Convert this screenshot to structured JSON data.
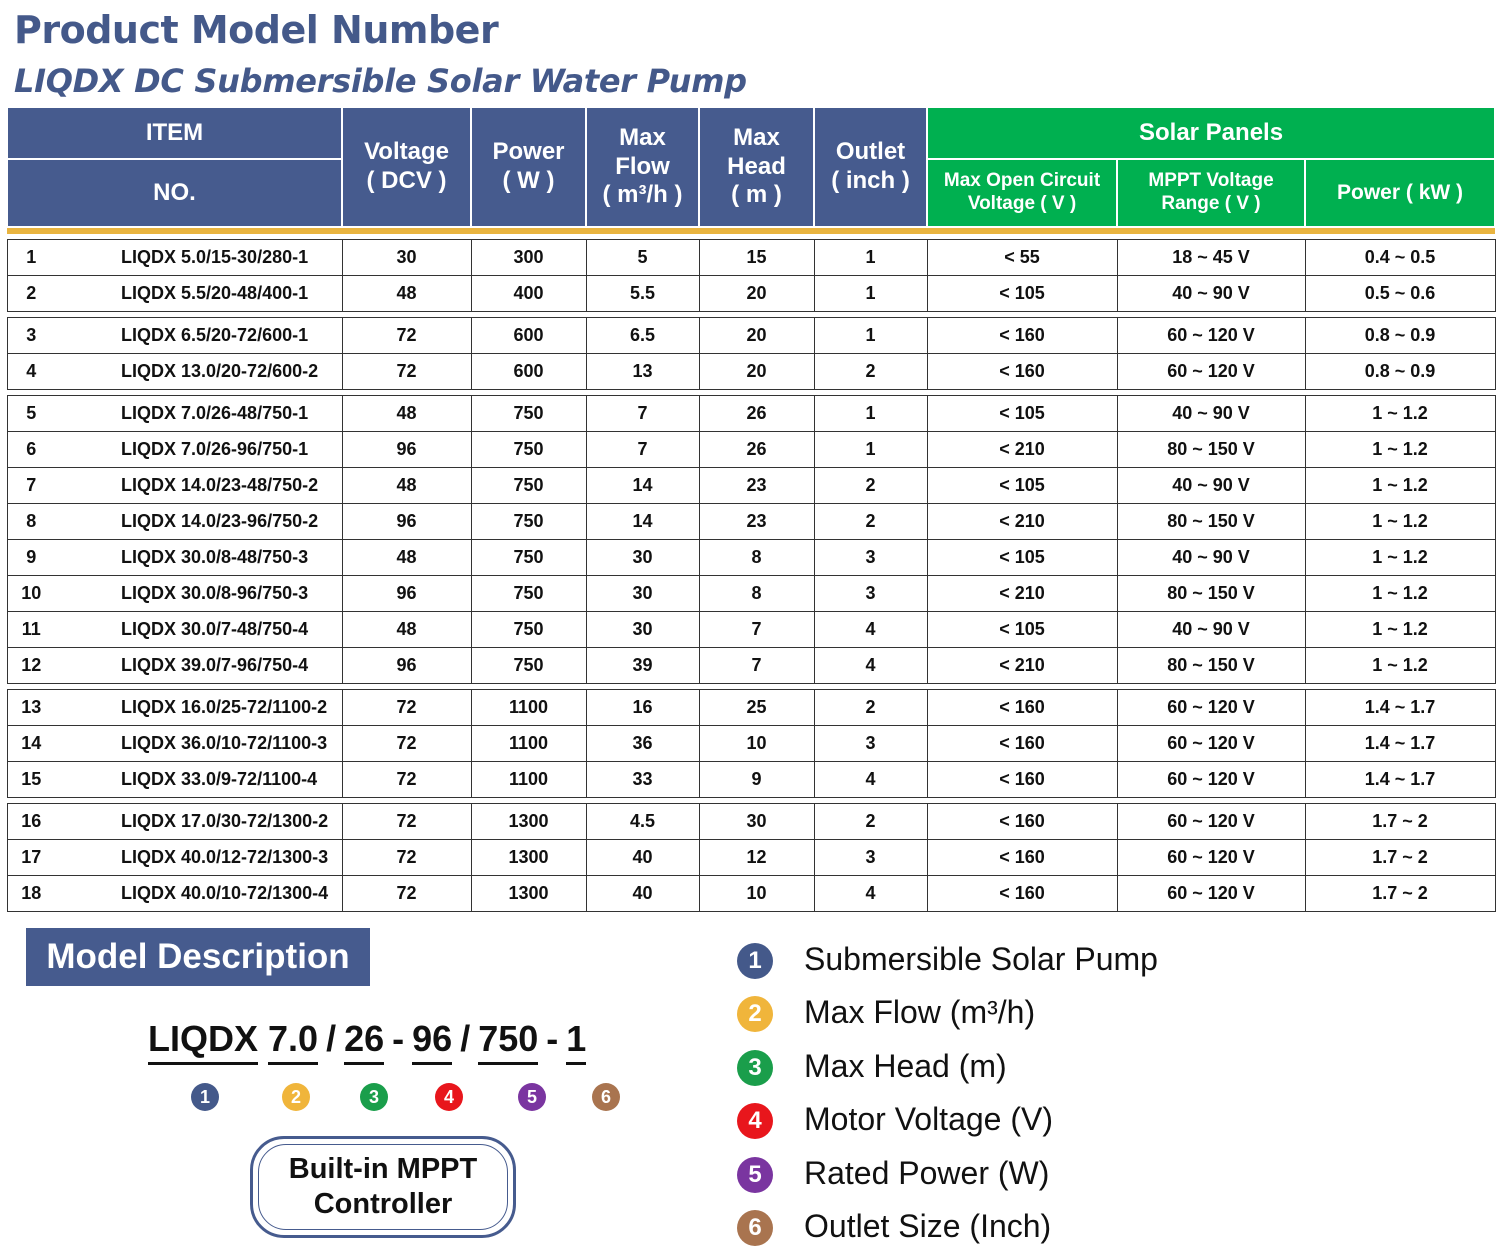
{
  "page": {
    "title": "Product Model Number",
    "subtitle": "LIQDX DC Submersible Solar Water Pump"
  },
  "table": {
    "headers": {
      "item": "ITEM",
      "no": "NO.",
      "voltage": "Voltage\n( DCV )",
      "power": "Power\n( W )",
      "max_flow": "Max\nFlow\n( m³/h )",
      "max_head": "Max\nHead\n( m )",
      "outlet": "Outlet\n( inch )",
      "solar_panels": "Solar Panels",
      "max_open_circuit": "Max Open Circuit\nVoltage ( V )",
      "mppt_range": "MPPT Voltage\nRange ( V )",
      "panel_power": "Power ( kW )"
    },
    "groups": [
      [
        [
          "1",
          "LIQDX 5.0/15-30/280-1",
          "30",
          "300",
          "5",
          "15",
          "1",
          "< 55",
          "18 ~ 45 V",
          "0.4 ~ 0.5"
        ],
        [
          "2",
          "LIQDX 5.5/20-48/400-1",
          "48",
          "400",
          "5.5",
          "20",
          "1",
          "< 105",
          "40 ~ 90 V",
          "0.5 ~ 0.6"
        ]
      ],
      [
        [
          "3",
          "LIQDX 6.5/20-72/600-1",
          "72",
          "600",
          "6.5",
          "20",
          "1",
          "< 160",
          "60 ~ 120 V",
          "0.8 ~ 0.9"
        ],
        [
          "4",
          "LIQDX 13.0/20-72/600-2",
          "72",
          "600",
          "13",
          "20",
          "2",
          "< 160",
          "60 ~ 120 V",
          "0.8 ~ 0.9"
        ]
      ],
      [
        [
          "5",
          "LIQDX 7.0/26-48/750-1",
          "48",
          "750",
          "7",
          "26",
          "1",
          "< 105",
          "40 ~ 90 V",
          "1 ~ 1.2"
        ],
        [
          "6",
          "LIQDX 7.0/26-96/750-1",
          "96",
          "750",
          "7",
          "26",
          "1",
          "< 210",
          "80 ~ 150 V",
          "1 ~ 1.2"
        ],
        [
          "7",
          "LIQDX 14.0/23-48/750-2",
          "48",
          "750",
          "14",
          "23",
          "2",
          "< 105",
          "40 ~ 90 V",
          "1 ~ 1.2"
        ],
        [
          "8",
          "LIQDX 14.0/23-96/750-2",
          "96",
          "750",
          "14",
          "23",
          "2",
          "< 210",
          "80 ~ 150 V",
          "1 ~ 1.2"
        ],
        [
          "9",
          "LIQDX 30.0/8-48/750-3",
          "48",
          "750",
          "30",
          "8",
          "3",
          "< 105",
          "40 ~ 90 V",
          "1 ~ 1.2"
        ],
        [
          "10",
          "LIQDX 30.0/8-96/750-3",
          "96",
          "750",
          "30",
          "8",
          "3",
          "< 210",
          "80 ~ 150 V",
          "1 ~ 1.2"
        ],
        [
          "11",
          "LIQDX 30.0/7-48/750-4",
          "48",
          "750",
          "30",
          "7",
          "4",
          "< 105",
          "40 ~ 90 V",
          "1 ~ 1.2"
        ],
        [
          "12",
          "LIQDX 39.0/7-96/750-4",
          "96",
          "750",
          "39",
          "7",
          "4",
          "< 210",
          "80 ~ 150 V",
          "1 ~ 1.2"
        ]
      ],
      [
        [
          "13",
          "LIQDX 16.0/25-72/1100-2",
          "72",
          "1100",
          "16",
          "25",
          "2",
          "< 160",
          "60 ~ 120 V",
          "1.4 ~ 1.7"
        ],
        [
          "14",
          "LIQDX 36.0/10-72/1100-3",
          "72",
          "1100",
          "36",
          "10",
          "3",
          "< 160",
          "60 ~ 120 V",
          "1.4 ~ 1.7"
        ],
        [
          "15",
          "LIQDX 33.0/9-72/1100-4",
          "72",
          "1100",
          "33",
          "9",
          "4",
          "< 160",
          "60 ~ 120 V",
          "1.4 ~ 1.7"
        ]
      ],
      [
        [
          "16",
          "LIQDX 17.0/30-72/1300-2",
          "72",
          "1300",
          "4.5",
          "30",
          "2",
          "< 160",
          "60 ~ 120 V",
          "1.7 ~ 2"
        ],
        [
          "17",
          "LIQDX 40.0/12-72/1300-3",
          "72",
          "1300",
          "40",
          "12",
          "3",
          "< 160",
          "60 ~ 120 V",
          "1.7 ~ 2"
        ],
        [
          "18",
          "LIQDX 40.0/10-72/1300-4",
          "72",
          "1300",
          "40",
          "10",
          "4",
          "< 160",
          "60 ~ 120 V",
          "1.7 ~ 2"
        ]
      ]
    ]
  },
  "model_description": {
    "heading": "Model Description",
    "code_parts": [
      {
        "text": "LIQDX",
        "num": "1"
      },
      {
        "sep": "7.0",
        "text": "7.0",
        "num": "2"
      },
      {
        "text": "26",
        "num": "3"
      },
      {
        "text": "96",
        "num": "4"
      },
      {
        "text": "750",
        "num": "5"
      },
      {
        "text": "1",
        "num": "6"
      }
    ],
    "separators": [
      "/",
      "-",
      "/",
      "-"
    ],
    "mppt_badge": "Built-in MPPT\nController"
  },
  "legend": [
    {
      "num": "1",
      "label": "Submersible Solar Pump",
      "color": "#44598a"
    },
    {
      "num": "2",
      "label": "Max Flow (m³/h)",
      "color": "#f0b53b"
    },
    {
      "num": "3",
      "label": "Max Head (m)",
      "color": "#1a9e4b"
    },
    {
      "num": "4",
      "label": "Motor Voltage (V)",
      "color": "#e8161c"
    },
    {
      "num": "5",
      "label": "Rated Power (W)",
      "color": "#7a35a0"
    },
    {
      "num": "6",
      "label": "Outlet Size (Inch)",
      "color": "#a9744f"
    }
  ]
}
